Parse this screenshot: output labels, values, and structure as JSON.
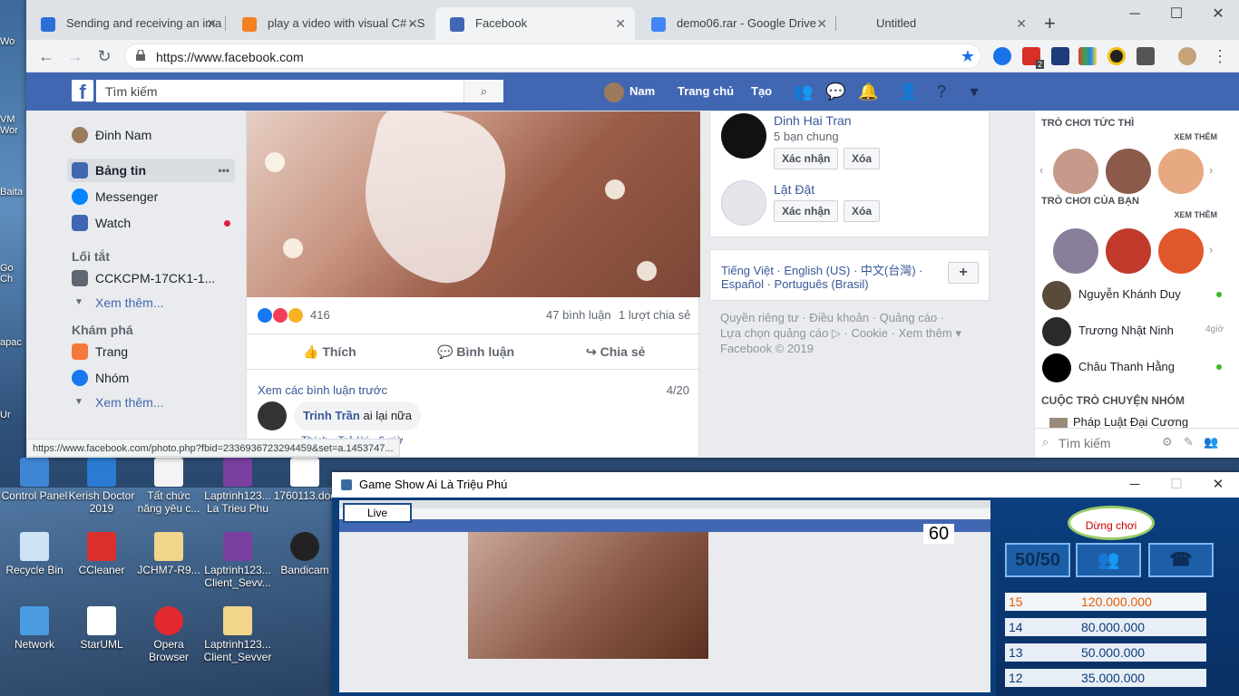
{
  "browser": {
    "tabs": [
      {
        "title": "Sending and receiving an ima",
        "color": "#2a6fd6"
      },
      {
        "title": "play a video with visual C# - S",
        "color": "#f48024"
      },
      {
        "title": "Facebook",
        "color": "#4267b2"
      },
      {
        "title": "demo06.rar - Google Drive",
        "color": "#4285f4"
      },
      {
        "title": "Untitled",
        "color": "#9aa0a6"
      }
    ],
    "new_tab": "+",
    "url": "https://www.facebook.com",
    "status_url": "https://www.facebook.com/photo.php?fbid=2336936723294459&set=a.1453747...",
    "ext_badge": "2"
  },
  "fb": {
    "logo": "f",
    "search_placeholder": "Tìm kiếm",
    "nav": {
      "profile": "Nam",
      "home": "Trang chủ",
      "create": "Tạo"
    },
    "left": {
      "profile_name": "Đinh Nam",
      "news_feed": "Bảng tin",
      "news_feed_more": "•••",
      "messenger": "Messenger",
      "watch": "Watch",
      "shortcuts_header": "Lối tắt",
      "group": "CCKCPM-17CK1-1...",
      "see_more_1": "Xem thêm...",
      "explore_header": "Khám phá",
      "pages": "Trang",
      "groups": "Nhóm",
      "see_more_2": "Xem thêm..."
    },
    "post": {
      "reactions_count": "416",
      "comments_count": "47 bình luận",
      "shares_count": "1 lượt chia sẻ",
      "like": "Thích",
      "comment": "Bình luận",
      "share": "Chia sẻ",
      "prev_comments": "Xem các bình luận trước",
      "comment_page": "4/20",
      "commenter": "Trinh Trần",
      "comment_text": "ai lại nữa",
      "comment_meta": "Thích · Trả lời · 6 giờ"
    },
    "suggestions": [
      {
        "name": "Dinh Hai Tran",
        "mutual": "5 bạn chung",
        "confirm": "Xác nhận",
        "remove": "Xóa"
      },
      {
        "name": "Lật Đật",
        "mutual": "",
        "confirm": "Xác nhận",
        "remove": "Xóa"
      }
    ],
    "languages": {
      "line1": "Tiếng Việt · English (US) · 中文(台灣) ·",
      "line2": "Español · Português (Brasil)",
      "add": "+"
    },
    "footer": {
      "line1": "Quyền riêng tư · Điều khoản · Quảng cáo ·",
      "line2": "Lựa chọn quảng cáo ▷ · Cookie · Xem thêm ▾",
      "copyright": "Facebook © 2019"
    },
    "chat": {
      "instant_games": "TRÒ CHƠI TỨC THÌ",
      "your_games": "TRÒ CHƠI CỦA BẠN",
      "see_more": "XEM THÊM",
      "friends": [
        {
          "name": "Nguyễn Khánh Duy",
          "status": "online"
        },
        {
          "name": "Trương Nhật Ninh",
          "status": "4giờ"
        },
        {
          "name": "Châu Thanh Hằng",
          "status": "online"
        }
      ],
      "group_header": "CUỘC TRÒ CHUYỆN NHÓM",
      "group_item": "Pháp Luật Đại Cương",
      "search_placeholder": "Tìm kiếm"
    }
  },
  "desktop": {
    "icons": [
      {
        "label": "Control Panel"
      },
      {
        "label": "Kerish Doctor 2019"
      },
      {
        "label": "Tất chức năng yêu c..."
      },
      {
        "label": "Laptrinh123... La Trieu Phu"
      },
      {
        "label": "1760113.doc"
      },
      {
        "label": "Recycle Bin"
      },
      {
        "label": "CCleaner"
      },
      {
        "label": "JCHM7-R9..."
      },
      {
        "label": "Laptrinh123... Client_Sevv..."
      },
      {
        "label": "Bandicam"
      },
      {
        "label": "Network"
      },
      {
        "label": "StarUML"
      },
      {
        "label": "Opera Browser"
      },
      {
        "label": "Laptrinh123... Client_Sevver"
      }
    ],
    "edge_labels": [
      "Wo",
      "VM Wor",
      "Baita",
      "Go Ch",
      "apac",
      "Ur"
    ]
  },
  "game": {
    "title": "Game Show Ai Là Triệu Phú",
    "live": "Live",
    "timer": "60",
    "stop": "Dừng chơi",
    "fifty": "50/50",
    "prizes": [
      {
        "level": "15",
        "amount": "120.000.000"
      },
      {
        "level": "14",
        "amount": "80.000.000"
      },
      {
        "level": "13",
        "amount": "50.000.000"
      },
      {
        "level": "12",
        "amount": "35.000.000"
      }
    ]
  }
}
